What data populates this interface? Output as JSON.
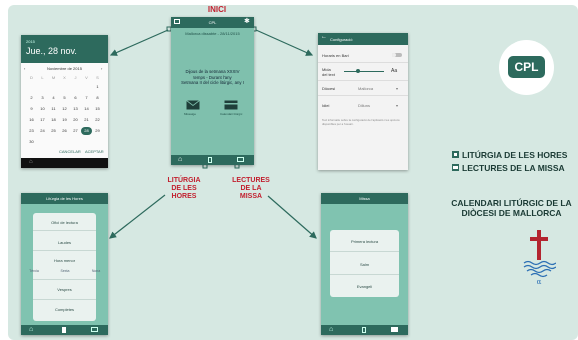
{
  "colors": {
    "accent": "#2d6a5d",
    "red_label": "#c2202f",
    "background": "#d6e8e2",
    "teal": "#57b09c",
    "dark_teal": "#1f4f47"
  },
  "labels": {
    "inici": "INICI",
    "liturgia": [
      "LITÚRGIA",
      "DE LES",
      "HORES"
    ],
    "lectures": [
      "LECTURES",
      "DE LA",
      "MISSA"
    ]
  },
  "legend": {
    "item1": "LITÚRGIA DE LES HORES",
    "item2": "LECTURES DE LA MISSA"
  },
  "calendar_title": [
    "CALENDARI LITÚRGIC DE LA",
    "DIÒCESI DE MALLORCA"
  ],
  "logo": {
    "text": "CPL"
  },
  "datepicker": {
    "year": "2015",
    "date": "Jue., 28 nov.",
    "month": "Noviembre de 2015",
    "weekdays": [
      "D",
      "L",
      "M",
      "X",
      "J",
      "V",
      "S"
    ],
    "rows": [
      [
        "",
        "",
        "",
        "",
        "",
        "",
        "1"
      ],
      [
        "2",
        "3",
        "4",
        "5",
        "6",
        "7",
        "8"
      ],
      [
        "9",
        "10",
        "11",
        "12",
        "13",
        "14",
        "15"
      ],
      [
        "16",
        "17",
        "18",
        "19",
        "20",
        "21",
        "22"
      ],
      [
        "23",
        "24",
        "25",
        "26",
        "27",
        "28",
        "29"
      ],
      [
        "30",
        "",
        "",
        "",
        "",
        "",
        ""
      ]
    ],
    "selected": "28",
    "cancel": "CANCELAR",
    "ok": "ACEPTAR"
  },
  "home_screen": {
    "title": "CPL",
    "subtitle": "Mallorca dissabte - 28/11/2015",
    "line1": "Dijous de la setmana XXXIV",
    "line2": "temps - Durant l'any",
    "line3": "Setmana II del cicle litúrgic, any I",
    "btn1": "Missatge",
    "btn2": "Calendari litúrgic"
  },
  "settings_screen": {
    "title": "Configuració",
    "rows": [
      {
        "label": "Horaris en Bari"
      },
      {
        "label": "Mida del text",
        "value": "Aa"
      },
      {
        "label": "Diòcesi",
        "value": "Mallorca"
      },
      {
        "label": "Idiei",
        "value": "Dilluns"
      }
    ],
    "note": "Text informatiu sobre la configuració de l'aplicació i les opcions disponibles per a l'usuari."
  },
  "hores_screen": {
    "title": "Litúrgia de les Hores",
    "items": [
      "Ofici de lectura",
      "Laudes",
      "Hora menor",
      "Vespres",
      "Completes"
    ],
    "sub_items": [
      "Tèrcia",
      "Sexta",
      "Nona"
    ]
  },
  "missa_screen": {
    "title": "Missa",
    "items": [
      "Primera lectura",
      "Salm",
      "Evangeli"
    ]
  }
}
